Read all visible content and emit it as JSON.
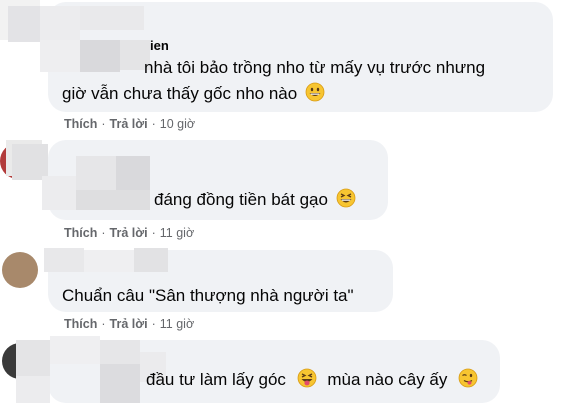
{
  "comments": [
    {
      "name_fragment": "ien",
      "text_lines": [
        "nhà tôi bảo trồng nho từ mấy vụ trước nhưng",
        "giờ vẫn chưa thấy gốc nho nào"
      ],
      "emoji": [
        "grin-emoji"
      ],
      "like": "Thích",
      "reply": "Trả lời",
      "time": "10 giờ"
    },
    {
      "name_fragment": "",
      "text_lines": [
        "đáng đồng tiền bát gạo"
      ],
      "emoji": [
        "laugh-squint-emoji"
      ],
      "like": "Thích",
      "reply": "Trả lời",
      "time": "11 giờ"
    },
    {
      "name_fragment": "",
      "text_lines": [
        "Chuẩn câu \"Sân thượng nhà người ta\""
      ],
      "emoji": [],
      "like": "Thích",
      "reply": "Trả lời",
      "time": "11 giờ"
    },
    {
      "name_fragment": "",
      "text_lines": [
        "đầu tư làm lấy góc",
        "mùa nào cây ấy"
      ],
      "emoji": [
        "tongue-out-emoji",
        "wink-tongue-emoji"
      ],
      "like": "Thích",
      "reply": "Trả lời",
      "time": "11 giờ"
    }
  ],
  "separator": "·",
  "colors": {
    "bubble": "#f0f2f5",
    "meta": "#65676b",
    "text": "#050505"
  }
}
